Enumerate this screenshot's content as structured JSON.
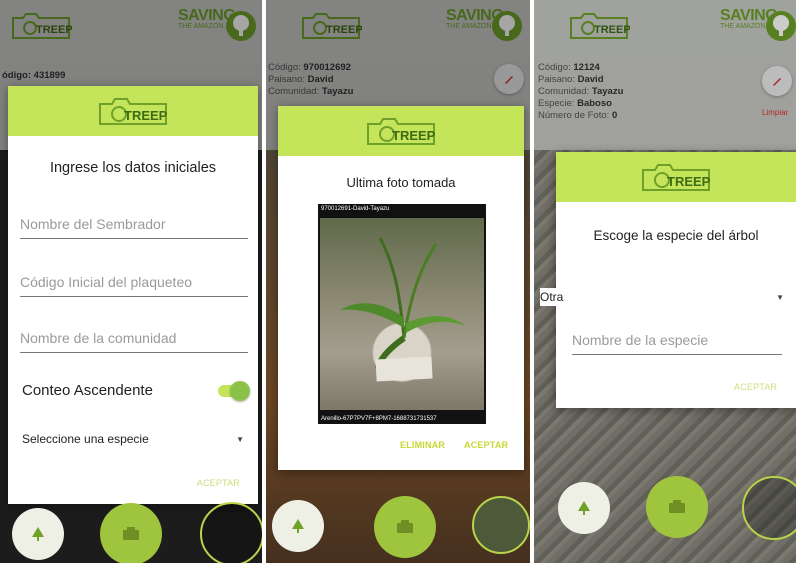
{
  "brand": {
    "logo_text": "TREEP",
    "saving": "SAVING",
    "amazon": "THE AMAZON"
  },
  "screen1": {
    "partial_code": "ódigo: 431899",
    "dialog_title": "Ingrese los datos iniciales",
    "fields": [
      "Nombre del Sembrador",
      "Código Inicial del plaqueteo",
      "Nombre de la comunidad"
    ],
    "switch_label": "Conteo Ascendente",
    "switch_on": true,
    "select_placeholder": "Seleccione una especie",
    "accept": "ACEPTAR"
  },
  "screen2": {
    "info": [
      {
        "label": "Código:",
        "value": "970012692"
      },
      {
        "label": "Paisano:",
        "value": "David"
      },
      {
        "label": "Comunidad:",
        "value": "Tayazu"
      }
    ],
    "dialog_title": "Ultima foto tomada",
    "photo_caption_top": "970012691-David-Tayazu",
    "photo_caption_bottom": "Arenillo-67P7PV7F+8PM7-1688731731537",
    "delete": "ELIMINAR",
    "accept": "ACEPTAR"
  },
  "screen3": {
    "info": [
      {
        "label": "Código:",
        "value": "12124"
      },
      {
        "label": "Paisano:",
        "value": "David"
      },
      {
        "label": "Comunidad:",
        "value": "Tayazu"
      },
      {
        "label": "Especie:",
        "value": "Baboso"
      },
      {
        "label": "Número de Foto:",
        "value": "0"
      }
    ],
    "clear": "Limpiar",
    "dialog_title": "Escoge la especie del árbol",
    "select_value": "Otra",
    "field": "Nombre de la especie",
    "accept": "ACEPTAR"
  },
  "colors": {
    "accent": "#c4e45a",
    "accent_dark": "#8bc34a",
    "button_green": "#9fc43d"
  }
}
